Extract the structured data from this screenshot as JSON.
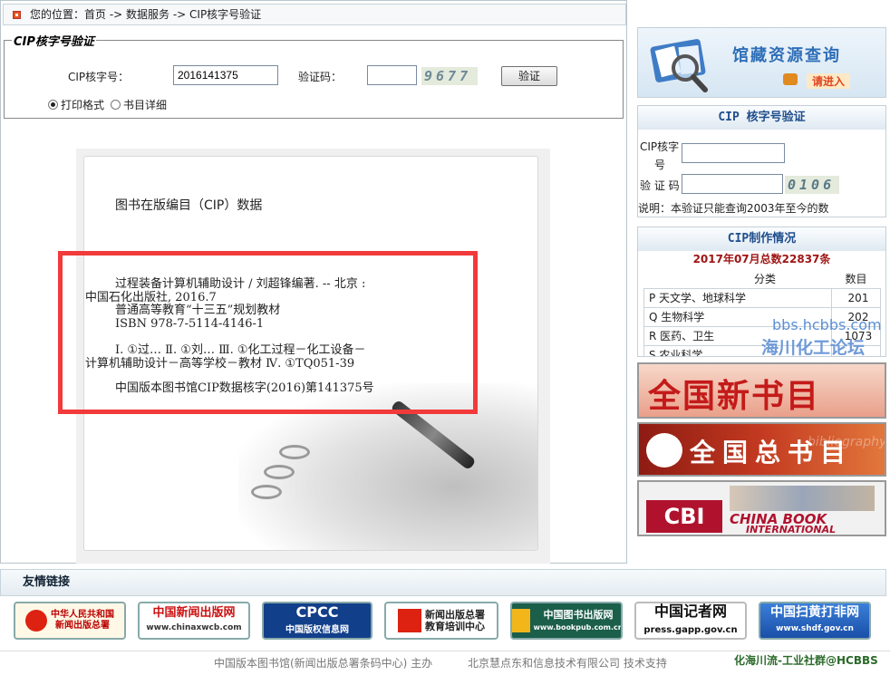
{
  "breadcrumb": {
    "text": "您的位置：首页 -> 数据服务 -> CIP核字号验证"
  },
  "verify_form": {
    "legend": "CIP核字号验证",
    "cip_label": "CIP核字号：",
    "cip_value": "2016141375",
    "captcha_label": "验证码：",
    "captcha_value": "",
    "captcha_text": "9677",
    "submit_label": "验证",
    "radio_print_label": "打印格式",
    "radio_detail_label": "书目详细"
  },
  "cip_record": {
    "heading": "图书在版编目（CIP）数据",
    "line1": "过程装备计算机辅助设计 / 刘超锋编著. -- 北京 :",
    "line2": "中国石化出版社, 2016.7",
    "line3": "普通高等教育“十三五”规划教材",
    "line4": "ISBN 978-7-5114-4146-1",
    "line5": "Ⅰ. ①过… Ⅱ. ①刘… Ⅲ. ①化工过程－化工设备－",
    "line6": "计算机辅助设计－高等学校－教材 Ⅳ. ①TQ051-39",
    "line7": "中国版本图书馆CIP数据核字(2016)第141375号"
  },
  "sidebar": {
    "library_search": {
      "title": "馆藏资源查询",
      "enter_label": "请进入"
    },
    "cip_box": {
      "title": "CIP 核字号验证",
      "cip_label_a": "CIP核字",
      "cip_label_b": "号",
      "captcha_label": "验 证 码",
      "captcha_text": "0106",
      "note": "说明：本验证只能查询2003年至今的数"
    },
    "stats": {
      "title": "CIP制作情况",
      "summary": "2017年07月总数22837条",
      "col_category": "分类",
      "col_count": "数目",
      "rows": [
        {
          "category": "P 天文学、地球科学",
          "count": "201"
        },
        {
          "category": "Q 生物科学",
          "count": "202"
        },
        {
          "category": "R 医药、卫生",
          "count": "1073"
        },
        {
          "category": "S 农业科学",
          "count": ""
        }
      ],
      "watermark_url": "bbs.hcbbs.com",
      "watermark_name": "海川化工论坛"
    },
    "banners": [
      {
        "text": "全国新书目"
      },
      {
        "text": "全国总书目",
        "sub": "bibliography"
      },
      {
        "text": "CHINA BOOK",
        "sub": "INTERNATIONAL",
        "badge": "CBI"
      }
    ]
  },
  "friend_links": {
    "title": "友情链接",
    "logos": [
      {
        "line1": "中华人民共和国",
        "line2": "新闻出版总署"
      },
      {
        "line1": "中国新闻出版网",
        "line2": "www.chinaxwcb.com"
      },
      {
        "line1": "CPCC",
        "line2": "中国版权信息网"
      },
      {
        "line1": "新闻出版总署",
        "line2": "教育培训中心"
      },
      {
        "line1": "中国图书出版网",
        "line2": "www.bookpub.com.cn"
      },
      {
        "line1": "中国记者网",
        "line2": "press.gapp.gov.cn"
      },
      {
        "line1": "中国扫黄打非网",
        "line2": "www.shdf.gov.cn"
      }
    ]
  },
  "footer": {
    "left": "中国版本图书馆(新闻出版总署条码中心)  主办",
    "right": "北京慧点东和信息技术有限公司  技术支持",
    "watermark": "化海川流-工业社群@HCBBS"
  },
  "colors": {
    "red_box": "#f23a3a",
    "accent_blue": "#1f4e8c",
    "dark_red": "#a01515"
  }
}
